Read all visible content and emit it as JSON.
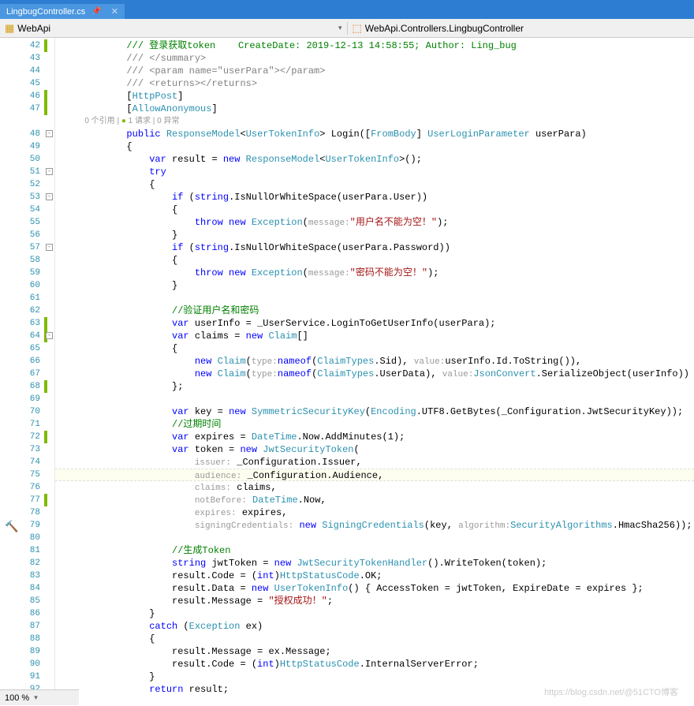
{
  "tab": {
    "filename": "LingbugController.cs"
  },
  "breadcrumb": {
    "left": "WebApi",
    "right": "WebApi.Controllers.LingbugController"
  },
  "codelens": {
    "refs": "0 个引用",
    "req": "1 请求",
    "exc": "0 异常"
  },
  "zoom": "100 %",
  "watermark": "https://blog.csdn.net/@51CTO博客",
  "lines": [
    {
      "n": 42,
      "bar": true,
      "t": "            /// 登录获取token    CreateDate: 2019-12-13 14:58:55; Author: Ling_bug",
      "cls": "c-comment"
    },
    {
      "n": 43,
      "t": "            /// </summary>",
      "cls": "c-gray"
    },
    {
      "n": 44,
      "t": "            /// <param name=\"userPara\"></param>",
      "cls": "c-gray"
    },
    {
      "n": 45,
      "t": "            /// <returns></returns>",
      "cls": "c-gray"
    },
    {
      "n": 46,
      "bar": true,
      "html": "            [<span class='c-type'>HttpPost</span>]"
    },
    {
      "n": 47,
      "bar": true,
      "html": "            [<span class='c-type'>AllowAnonymous</span>]"
    },
    {
      "codelens": true
    },
    {
      "n": 48,
      "fold": "-",
      "html": "            <span class='c-keyword'>public</span> <span class='c-type'>ResponseModel</span>&lt;<span class='c-type'>UserTokenInfo</span>&gt; Login([<span class='c-type'>FromBody</span>] <span class='c-type'>UserLoginParameter</span> userPara)"
    },
    {
      "n": 49,
      "t": "            {"
    },
    {
      "n": 50,
      "html": "                <span class='c-keyword'>var</span> result = <span class='c-keyword'>new</span> <span class='c-type'>ResponseModel</span>&lt;<span class='c-type'>UserTokenInfo</span>&gt;();"
    },
    {
      "n": 51,
      "fold": "-",
      "html": "                <span class='c-keyword'>try</span>"
    },
    {
      "n": 52,
      "t": "                {"
    },
    {
      "n": 53,
      "fold": "-",
      "html": "                    <span class='c-keyword'>if</span> (<span class='c-keyword'>string</span>.IsNullOrWhiteSpace(userPara.User))"
    },
    {
      "n": 54,
      "t": "                    {"
    },
    {
      "n": 55,
      "html": "                        <span class='c-keyword'>throw new</span> <span class='c-type'>Exception</span>(<span class='c-hint'>message:</span><span class='c-string'>\"用户名不能为空！\"</span>);"
    },
    {
      "n": 56,
      "t": "                    }"
    },
    {
      "n": 57,
      "fold": "-",
      "html": "                    <span class='c-keyword'>if</span> (<span class='c-keyword'>string</span>.IsNullOrWhiteSpace(userPara.Password))"
    },
    {
      "n": 58,
      "t": "                    {"
    },
    {
      "n": 59,
      "html": "                        <span class='c-keyword'>throw new</span> <span class='c-type'>Exception</span>(<span class='c-hint'>message:</span><span class='c-string'>\"密码不能为空！\"</span>);"
    },
    {
      "n": 60,
      "t": "                    }"
    },
    {
      "n": 61,
      "t": ""
    },
    {
      "n": 62,
      "html": "                    <span class='c-comment'>//验证用户名和密码</span>"
    },
    {
      "n": 63,
      "bar": true,
      "html": "                    <span class='c-keyword'>var</span> userInfo = _UserService.LoginToGetUserInfo(userPara);"
    },
    {
      "n": 64,
      "bar": true,
      "fold": "-",
      "html": "                    <span class='c-keyword'>var</span> claims = <span class='c-keyword'>new</span> <span class='c-type'>Claim</span>[]"
    },
    {
      "n": 65,
      "t": "                    {"
    },
    {
      "n": 66,
      "html": "                        <span class='c-keyword'>new</span> <span class='c-type'>Claim</span>(<span class='c-hint'>type:</span><span class='c-keyword'>nameof</span>(<span class='c-type'>ClaimTypes</span>.Sid), <span class='c-hint'>value:</span>userInfo.Id.ToString()),"
    },
    {
      "n": 67,
      "html": "                        <span class='c-keyword'>new</span> <span class='c-type'>Claim</span>(<span class='c-hint'>type:</span><span class='c-keyword'>nameof</span>(<span class='c-type'>ClaimTypes</span>.UserData), <span class='c-hint'>value:</span><span class='c-type'>JsonConvert</span>.SerializeObject(userInfo))"
    },
    {
      "n": 68,
      "bar": true,
      "t": "                    };"
    },
    {
      "n": 69,
      "t": ""
    },
    {
      "n": 70,
      "html": "                    <span class='c-keyword'>var</span> key = <span class='c-keyword'>new</span> <span class='c-type'>SymmetricSecurityKey</span>(<span class='c-type'>Encoding</span>.UTF8.GetBytes(_Configuration.JwtSecurityKey));"
    },
    {
      "n": 71,
      "html": "                    <span class='c-comment'>//过期时间</span>"
    },
    {
      "n": 72,
      "bar": true,
      "html": "                    <span class='c-keyword'>var</span> expires = <span class='c-type'>DateTime</span>.Now.AddMinutes(1);"
    },
    {
      "n": 73,
      "html": "                    <span class='c-keyword'>var</span> token = <span class='c-keyword'>new</span> <span class='c-type'>JwtSecurityToken</span>("
    },
    {
      "n": 74,
      "html": "                        <span class='c-hint'>issuer:</span> _Configuration.Issuer,"
    },
    {
      "n": 75,
      "hl": true,
      "html": "                        <span class='c-hint'>audience:</span> _Configuration.Audience,"
    },
    {
      "n": 76,
      "html": "                        <span class='c-hint'>claims:</span> claims,"
    },
    {
      "n": 77,
      "bar": true,
      "html": "                        <span class='c-hint'>notBefore:</span> <span class='c-type'>DateTime</span>.Now,"
    },
    {
      "n": 78,
      "html": "                        <span class='c-hint'>expires:</span> expires,"
    },
    {
      "n": 79,
      "html": "                        <span class='c-hint'>signingCredentials:</span> <span class='c-keyword'>new</span> <span class='c-type'>SigningCredentials</span>(key, <span class='c-hint'>algorithm:</span><span class='c-type'>SecurityAlgorithms</span>.HmacSha256));"
    },
    {
      "n": 80,
      "t": ""
    },
    {
      "n": 81,
      "html": "                    <span class='c-comment'>//生成Token</span>"
    },
    {
      "n": 82,
      "html": "                    <span class='c-keyword'>string</span> jwtToken = <span class='c-keyword'>new</span> <span class='c-type'>JwtSecurityTokenHandler</span>().WriteToken(token);"
    },
    {
      "n": 83,
      "html": "                    result.Code = (<span class='c-keyword'>int</span>)<span class='c-type'>HttpStatusCode</span>.OK;"
    },
    {
      "n": 84,
      "html": "                    result.Data = <span class='c-keyword'>new</span> <span class='c-type'>UserTokenInfo</span>() { AccessToken = jwtToken, ExpireDate = expires };"
    },
    {
      "n": 85,
      "html": "                    result.Message = <span class='c-string'>\"授权成功！\"</span>;"
    },
    {
      "n": 86,
      "t": "                }"
    },
    {
      "n": 87,
      "html": "                <span class='c-keyword'>catch</span> (<span class='c-type'>Exception</span> ex)"
    },
    {
      "n": 88,
      "t": "                {"
    },
    {
      "n": 89,
      "t": "                    result.Message = ex.Message;"
    },
    {
      "n": 90,
      "html": "                    result.Code = (<span class='c-keyword'>int</span>)<span class='c-type'>HttpStatusCode</span>.InternalServerError;"
    },
    {
      "n": 91,
      "t": "                }"
    },
    {
      "n": 92,
      "html": "                <span class='c-keyword'>return</span> result;"
    }
  ]
}
